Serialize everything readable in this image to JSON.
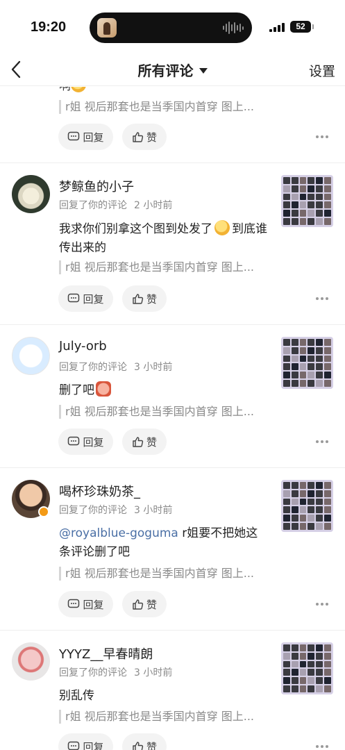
{
  "status_bar": {
    "time": "19:20",
    "battery": "52"
  },
  "nav": {
    "title": "所有评论",
    "settings": "设置"
  },
  "partial": {
    "text_fragment": "啊",
    "quote": "r姐 视后那套也是当季国内首穿 图上..."
  },
  "actions": {
    "reply": "回复",
    "like": "赞"
  },
  "comments": [
    {
      "username": "梦鲸鱼的小子",
      "meta": "回复了你的评论",
      "time": "2 小时前",
      "text_1": "我求你们别拿这个图到处发了",
      "text_2": "到底谁传出来的",
      "quote": "r姐 视后那套也是当季国内首穿 图上..."
    },
    {
      "username": "July-orb",
      "meta": "回复了你的评论",
      "time": "3 小时前",
      "text_1": "删了吧",
      "quote": "r姐 视后那套也是当季国内首穿 图上..."
    },
    {
      "username": "喝杯珍珠奶茶_",
      "meta": "回复了你的评论",
      "time": "3 小时前",
      "mention": "@royalblue-goguma",
      "text_1": " r姐要不把她这条评论删了吧",
      "quote": "r姐 视后那套也是当季国内首穿 图上..."
    },
    {
      "username": "YYYZ__早春晴朗",
      "meta": "回复了你的评论",
      "time": "3 小时前",
      "text_1": "别乱传",
      "quote": "r姐 视后那套也是当季国内首穿 图上..."
    }
  ]
}
